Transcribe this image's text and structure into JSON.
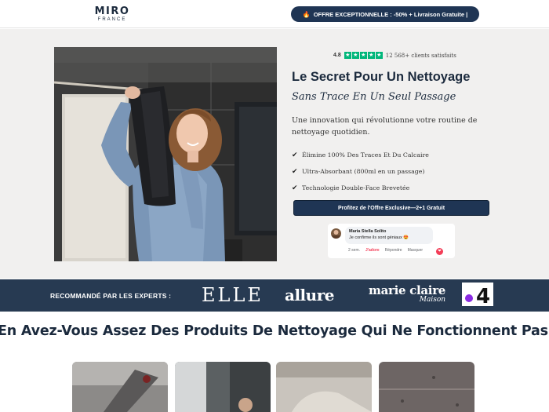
{
  "header": {
    "logo_main": "MIRO",
    "logo_sub": "FRANCE",
    "offer_icon": "fire-icon",
    "offer_text": "OFFRE EXCEPTIONNELLE : -50% + Livraison Gratuite |"
  },
  "hero": {
    "rating": {
      "score": "4.8",
      "star_count": 5,
      "text": "12 568+ clients satisfaits"
    },
    "title": "Le Secret Pour Un Nettoyage",
    "subtitle": "Sans Trace En Un Seul Passage",
    "description": "Une innovation qui révolutionne votre routine de nettoyage quotidien.",
    "features": [
      {
        "icon": "check-icon",
        "text": "Élimine 100% Des Traces Et Du Calcaire"
      },
      {
        "icon": "check-icon",
        "text": "Ultra-Absorbant (800ml en un passage)"
      },
      {
        "icon": "check-icon",
        "text": "Technologie Double-Face Brevetée"
      }
    ],
    "cta_label": "Profitez de l'Offre Exclusive—2+1 Gratuit",
    "comment": {
      "author": "Maria Stella Solito",
      "text": "Je confirme ils sont géniaux 😍",
      "time": "2 sem.",
      "like_label": "J'adore",
      "reply_label": "Répondre",
      "hide_label": "Masquer"
    }
  },
  "experts": {
    "label": "RECOMMANDÉ PAR LES EXPERTS :",
    "brands": {
      "elle": "ELLE",
      "allure": "allure",
      "marie_claire": "marie claire",
      "marie_claire_sub": "Maison",
      "m6": "4"
    }
  },
  "section": {
    "title": "En Avez-Vous Assez Des Produits De Nettoyage Qui Ne Fonctionnent Pas ?"
  },
  "colors": {
    "navy": "#1f3554",
    "band": "#273a52",
    "hero_bg": "#f1f0ef",
    "trustpilot_green": "#00b67a"
  }
}
